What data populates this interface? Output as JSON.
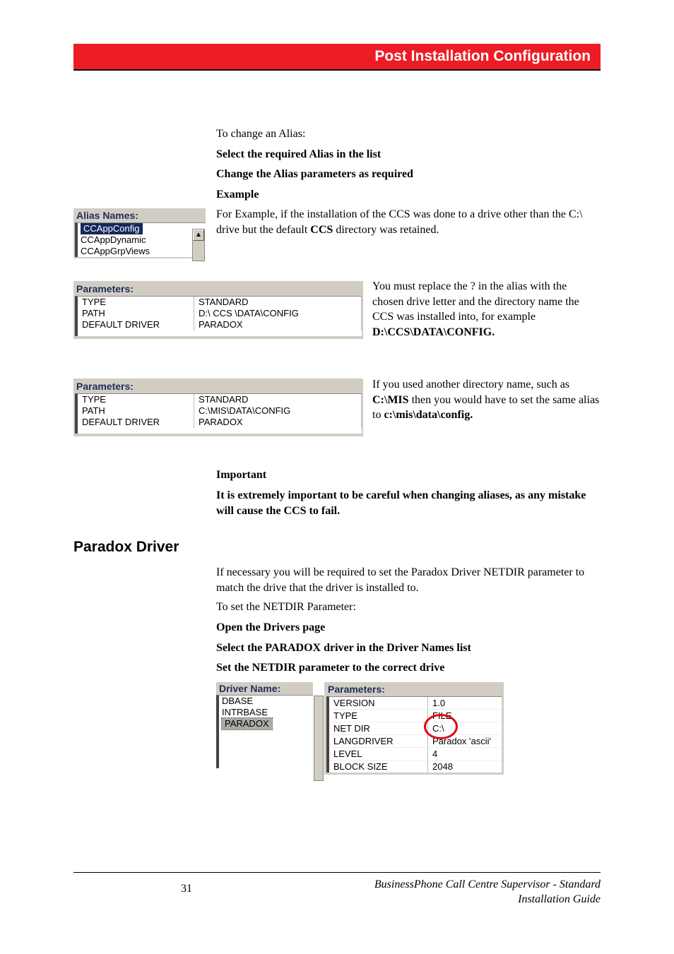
{
  "header": {
    "title": "Post Installation Configuration"
  },
  "intro": {
    "to_change": "To change an Alias:",
    "select": "Select the required Alias in the list",
    "change": "Change the Alias parameters as required",
    "example_label": "Example",
    "example_text_1": "For Example, if the installation of the CCS was done to a drive other than the C:\\ drive but the default ",
    "example_text_2": " directory was retained.",
    "example_bold": "CCS"
  },
  "alias": {
    "title": "Alias Names:",
    "items": [
      "CCAppConfig",
      "CCAppDynamic",
      "CCAppGrpViews"
    ],
    "selected": 0
  },
  "side1": {
    "p1a": "You must replace the ? in the alias with the chosen drive letter and the directory name the CCS was installed into, for example ",
    "p1b": "D:\\CCS\\DATA\\CONFIG."
  },
  "params1": {
    "title": "Parameters:",
    "rows": [
      {
        "k": "TYPE",
        "v": "STANDARD"
      },
      {
        "k": "PATH",
        "v": "D:\\ CCS \\DATA\\CONFIG"
      },
      {
        "k": "DEFAULT DRIVER",
        "v": "PARADOX"
      }
    ]
  },
  "side2": {
    "p1a": "If you used another directory name, such as ",
    "p1b": "C:\\MIS",
    "p1c": " then you would have to set the same alias to ",
    "p1d": "c:\\mis\\data\\config."
  },
  "params2": {
    "title": "Parameters:",
    "rows": [
      {
        "k": "TYPE",
        "v": "STANDARD"
      },
      {
        "k": "PATH",
        "v": "C:\\MIS\\DATA\\CONFIG"
      },
      {
        "k": "DEFAULT DRIVER",
        "v": "PARADOX"
      }
    ]
  },
  "important": {
    "label": "Important",
    "text": "It is extremely important to be careful when changing aliases, as any mistake will cause the CCS to fail."
  },
  "section": {
    "heading": "Paradox Driver"
  },
  "driver_intro": {
    "p1": "If necessary you will be required to set the Paradox Driver NETDIR parameter to match the drive that the driver is installed to.",
    "p2": "To set the NETDIR Parameter:",
    "step1": "Open the Drivers page",
    "step2": "Select the PARADOX driver in the Driver Names list",
    "step3": "Set the NETDIR parameter to the correct drive"
  },
  "driver_name": {
    "title": "Driver Name:",
    "items": [
      "DBASE",
      "INTRBASE",
      "PARADOX"
    ],
    "selected": 2
  },
  "driver_params": {
    "title": "Parameters:",
    "rows": [
      {
        "k": "VERSION",
        "v": "1.0"
      },
      {
        "k": "TYPE",
        "v": "FILE"
      },
      {
        "k": "NET DIR",
        "v": "C:\\"
      },
      {
        "k": "LANGDRIVER",
        "v": "Paradox 'ascii'"
      },
      {
        "k": "LEVEL",
        "v": "4"
      },
      {
        "k": "BLOCK SIZE",
        "v": "2048"
      }
    ]
  },
  "footer": {
    "page": "31",
    "line1": "BusinessPhone Call Centre Supervisor - Standard",
    "line2": "Installation Guide"
  },
  "icons": {
    "up": "▲"
  }
}
